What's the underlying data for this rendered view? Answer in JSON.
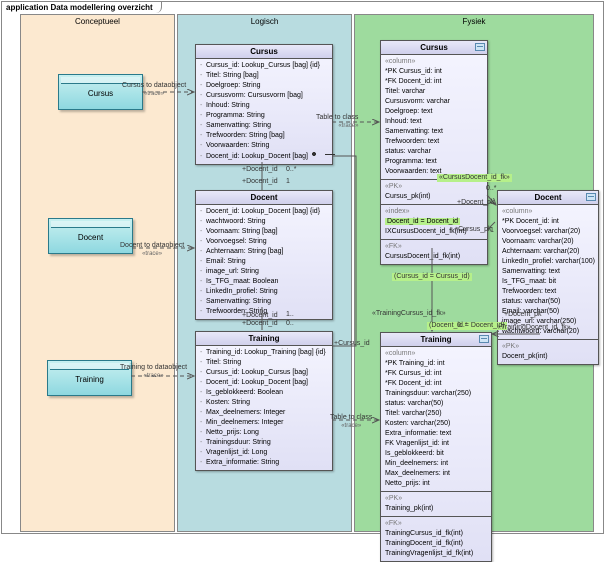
{
  "frame_title": "application Data modellering overzicht",
  "lanes": {
    "conceptueel": "Conceptueel",
    "logisch": "Logisch",
    "fysiek": "Fysiek"
  },
  "concepts": {
    "cursus": "Cursus",
    "docent": "Docent",
    "training": "Training"
  },
  "logical": {
    "cursus": {
      "title": "Cursus",
      "attrs": [
        "Cursus_id: Lookup_Cursus [bag] {id}",
        "Titel: String [bag]",
        "Doelgroep: String",
        "Cursusvorm: Cursusvorm [bag]",
        "Inhoud: String",
        "Programma: String",
        "Samenvatting: String",
        "Trefwoorden: String [bag]",
        "Voorwaarden: String",
        "Docent_id: Lookup_Docent [bag]"
      ]
    },
    "docent": {
      "title": "Docent",
      "attrs": [
        "Docent_id: Lookup_Docent [bag] {id}",
        "wachtwoord: String",
        "Voornaam: String [bag]",
        "Voorvoegsel: String",
        "Achternaam: String [bag]",
        "Email: String",
        "image_url: String",
        "Is_TFG_maat: Boolean",
        "LinkedIn_profiel: String",
        "Samenvatting: String",
        "Trefwoorden: String"
      ]
    },
    "training": {
      "title": "Training",
      "attrs": [
        "Training_id: Lookup_Training [bag] {id}",
        "Titel: String",
        "Cursus_id: Lookup_Cursus [bag]",
        "Docent_id: Lookup_Docent [bag]",
        "Is_geblokkeerd: Boolean",
        "Kosten: String",
        "Max_deelnemers: Integer",
        "Min_deelnemers: Integer",
        "Netto_prijs: Long",
        "Trainingsduur: String",
        "Vragenlijst_id: Long",
        "Extra_informatie: String"
      ]
    }
  },
  "physical": {
    "cursus": {
      "title": "Cursus",
      "column_h": "«column»",
      "cols": [
        "*PK  Cursus_id: int",
        "*FK  Docent_id: int",
        "     Titel: varchar",
        "     Cursusvorm: varchar",
        "     Doelgroep: text",
        "     Inhoud: text",
        "     Samenvatting: text",
        "     Trefwoorden: text",
        "     status: varchar",
        "     Programma: text",
        "     Voorwaarden: text"
      ],
      "pk_h": "«PK»",
      "pk": "Cursus_pk(int)",
      "idx_h": "«index»",
      "idx1": "Docent_id = Docent_id",
      "idx2": "IXCursusDocent_id_fk(int)",
      "fk_h": "«FK»",
      "fk": "CursusDocent_id_fk(int)",
      "rel_label": "«CursusDocent_id_fk»"
    },
    "docent": {
      "title": "Docent",
      "column_h": "«column»",
      "cols": [
        "*PK  Docent_id: int",
        "     Voorvoegsel: varchar(20)",
        "     Voornaam: varchar(20)",
        "     Achternaam: varchar(20)",
        "     LinkedIn_profiel: varchar(100)",
        "     Samenvatting: text",
        "     Is_TFG_maat: bit",
        "     Trefwoorden: text",
        "     status: varchar(50)",
        "     Email: varchar(50)",
        "     image_url: varchar(250)",
        "     wachtwoord: varchar(20)"
      ],
      "pk_h": "«PK»",
      "pk": "Docent_pk(int)"
    },
    "training": {
      "title": "Training",
      "column_h": "«column»",
      "cols": [
        "*PK  Training_id: int",
        "*FK  Cursus_id: int",
        "*FK  Docent_id: int",
        "     Trainingsduur: varchar(250)",
        "     status: varchar(50)",
        "     Titel: varchar(250)",
        "     Kosten: varchar(250)",
        "     Extra_informatie: text",
        " FK  Vragenlijst_id: int",
        "     Is_geblokkeerd: bit",
        "     Min_deelnemers: int",
        "     Max_deelnemers: int",
        "     Netto_prijs: int"
      ],
      "pk_h": "«PK»",
      "pk": "Training_pk(int)",
      "fk_h": "«FK»",
      "fks": [
        "TrainingCursus_id_fk(int)",
        "TrainingDocent_id_fk(int)",
        "TrainingVragenlijst_id_fk(int)"
      ],
      "rel_cursus": "«TrainingCursus_id_fk»",
      "rel_docent": "«TrainingDocent_id_fk»",
      "hl1": "(Cursus_id = Cursus_id)",
      "hl2": "(Docent_id = Docent_id)"
    }
  },
  "edges": {
    "c_cursus": {
      "name": "Cursus to dataobject",
      "trace": "«trace»"
    },
    "c_docent": {
      "name": "Docent to dataobject",
      "trace": "«trace»"
    },
    "c_training": {
      "name": "Training to dataobject",
      "trace": "«trace»"
    },
    "l_cursus": {
      "name": "Table to class",
      "trace": "«trace»"
    },
    "l_training": {
      "name": "Table to class",
      "trace": "«trace»"
    },
    "docent_link": {
      "a": "+Docent_id",
      "b": "+Docent_id"
    },
    "cursus_link": {
      "a": "+Cursus_id",
      "b": "+Cursus_id"
    },
    "cursus_pk": {
      "a": "+Cursus_pk",
      "b": "+Docent_pk"
    },
    "docent_pk": {
      "a": "+Docent_pk"
    }
  },
  "mults": {
    "one": "1",
    "many": "0..*",
    "one_dots": "1..",
    "zero_dot": "0.."
  }
}
